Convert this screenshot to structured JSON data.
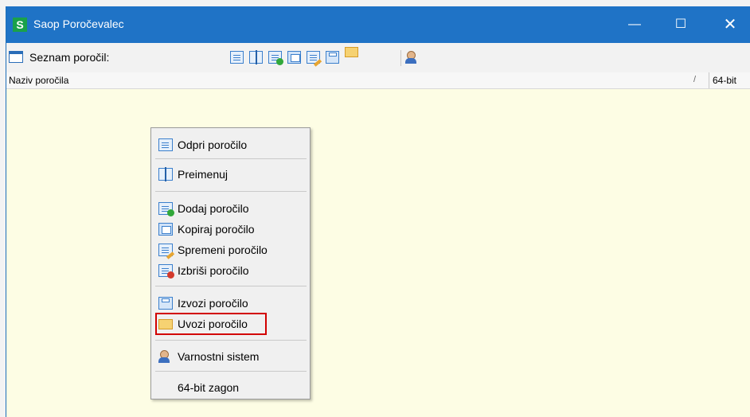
{
  "window": {
    "title": "Saop Poročevalec",
    "logo_letter": "S",
    "controls": {
      "minimize": "—",
      "maximize": "☐",
      "close": "✕"
    }
  },
  "toolbar": {
    "label": "Seznam poročil:",
    "buttons": [
      "open-report",
      "rename",
      "add-report",
      "copy-report",
      "edit-report",
      "export-report",
      "import-report",
      "security"
    ]
  },
  "header": {
    "column_name": "Naziv poročila",
    "sort_indicator": "/",
    "column_bit": "64-bit"
  },
  "context_menu": {
    "items": [
      {
        "label": "Odpri poročilo",
        "icon": "document-icon"
      },
      {
        "label": "Preimenuj",
        "icon": "rename-icon"
      },
      {
        "label": "Dodaj poročilo",
        "icon": "add-document-icon"
      },
      {
        "label": "Kopiraj poročilo",
        "icon": "copy-icon"
      },
      {
        "label": "Spremeni poročilo",
        "icon": "edit-icon"
      },
      {
        "label": "Izbriši poročilo",
        "icon": "delete-icon"
      },
      {
        "label": "Izvozi poročilo",
        "icon": "floppy-icon"
      },
      {
        "label": "Uvozi poročilo",
        "icon": "folder-icon",
        "highlighted": true
      },
      {
        "label": "Varnostni sistem",
        "icon": "security-icon"
      },
      {
        "label": "64-bit zagon",
        "icon": ""
      }
    ]
  },
  "colors": {
    "titlebar": "#1f73c6",
    "content_bg": "#fdfde4",
    "highlight_border": "#d20000"
  }
}
